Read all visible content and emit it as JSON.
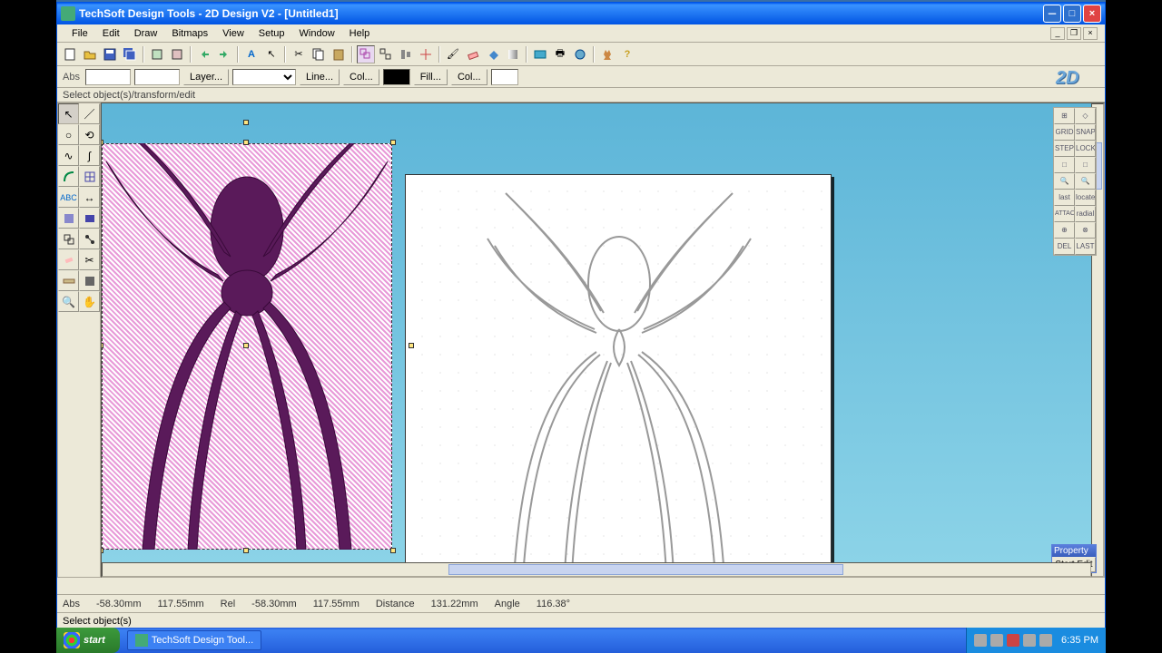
{
  "window": {
    "title": "TechSoft Design Tools - 2D Design V2 - [Untitled1]",
    "logo": "2D"
  },
  "menu": {
    "items": [
      "File",
      "Edit",
      "Draw",
      "Bitmaps",
      "View",
      "Setup",
      "Window",
      "Help"
    ]
  },
  "toolbar2": {
    "abs_label": "Abs",
    "layer_label": "Layer...",
    "line_label": "Line...",
    "col_label": "Col...",
    "fill_label": "Fill...",
    "col2_label": "Col..."
  },
  "hint": "Select object(s)/transform/edit",
  "right_palette": {
    "labels": [
      "GRID",
      "SNAP",
      "STEP",
      "LOCK",
      "last",
      "locate",
      "ATTACH",
      "radial",
      "DEL",
      "LAST"
    ]
  },
  "property": {
    "title": "Property",
    "button": "Start Edit"
  },
  "status": {
    "abs_label": "Abs",
    "abs_x": "-58.30mm",
    "abs_y": "117.55mm",
    "rel_label": "Rel",
    "rel_x": "-58.30mm",
    "rel_y": "117.55mm",
    "dist_label": "Distance",
    "dist_val": "131.22mm",
    "angle_label": "Angle",
    "angle_val": "116.38°"
  },
  "status2": "Select object(s)",
  "taskbar": {
    "start": "start",
    "task": "TechSoft Design Tool...",
    "time": "6:35 PM"
  },
  "colors": {
    "spider_fill": "#5a1a5a",
    "selection_bg": "#e89ad8",
    "canvas_bg_top": "#5db5d8",
    "canvas_bg_bot": "#8dd4e8"
  }
}
